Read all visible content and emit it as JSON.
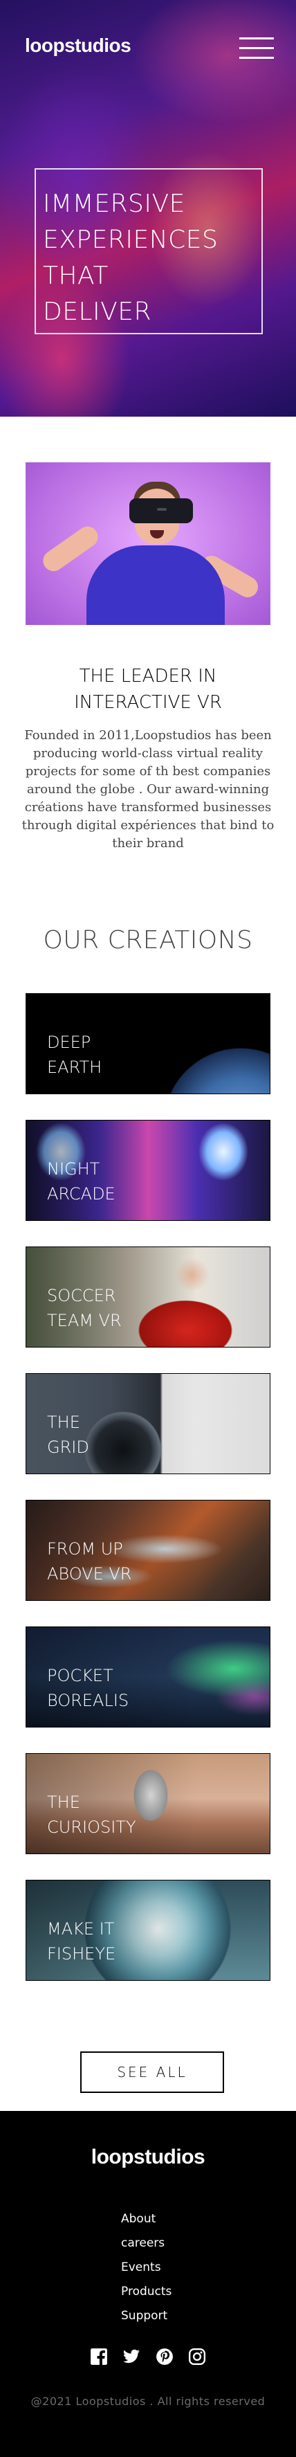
{
  "header": {
    "logo": "loopstudios",
    "menu_icon": "hamburger-menu-icon"
  },
  "hero": {
    "title": "IMMERSIVE\nEXPERIENCES\nTHAT\nDELIVER"
  },
  "intro": {
    "heading": "THE LEADER IN\nINTERACTIVE VR",
    "text": "Founded in 2011,Loopstudios has been producing world-class virtual reality projects for some of th best companies around the globe . Our award-winning créations have transformed businesses through digital expériences that bind to their brand"
  },
  "creations": {
    "title": "OUR CREATIONS",
    "cards": [
      {
        "label": "DEEP\nEARTH"
      },
      {
        "label": "NIGHT\nARCADE"
      },
      {
        "label": "SOCCER\nTEAM VR"
      },
      {
        "label": "THE\nGRID"
      },
      {
        "label": "FROM UP\nABOVE VR"
      },
      {
        "label": "POCKET\nBOREALIS"
      },
      {
        "label": "THE\nCURIOSITY"
      },
      {
        "label": "MAKE IT\nFISHEYE"
      }
    ],
    "see_all_label": "SEE ALL"
  },
  "footer": {
    "logo": "loopstudios",
    "links": [
      "About",
      "careers",
      "Events",
      "Products",
      "Support"
    ],
    "socials": [
      "facebook-icon",
      "twitter-icon",
      "pinterest-icon",
      "instagram-icon"
    ],
    "copyright": "@2021 Loopstudios . All rights reserved"
  },
  "colors": {
    "footer_bg": "#000000",
    "text_white": "#ffffff",
    "copyright_gray": "#6b6b6b"
  }
}
